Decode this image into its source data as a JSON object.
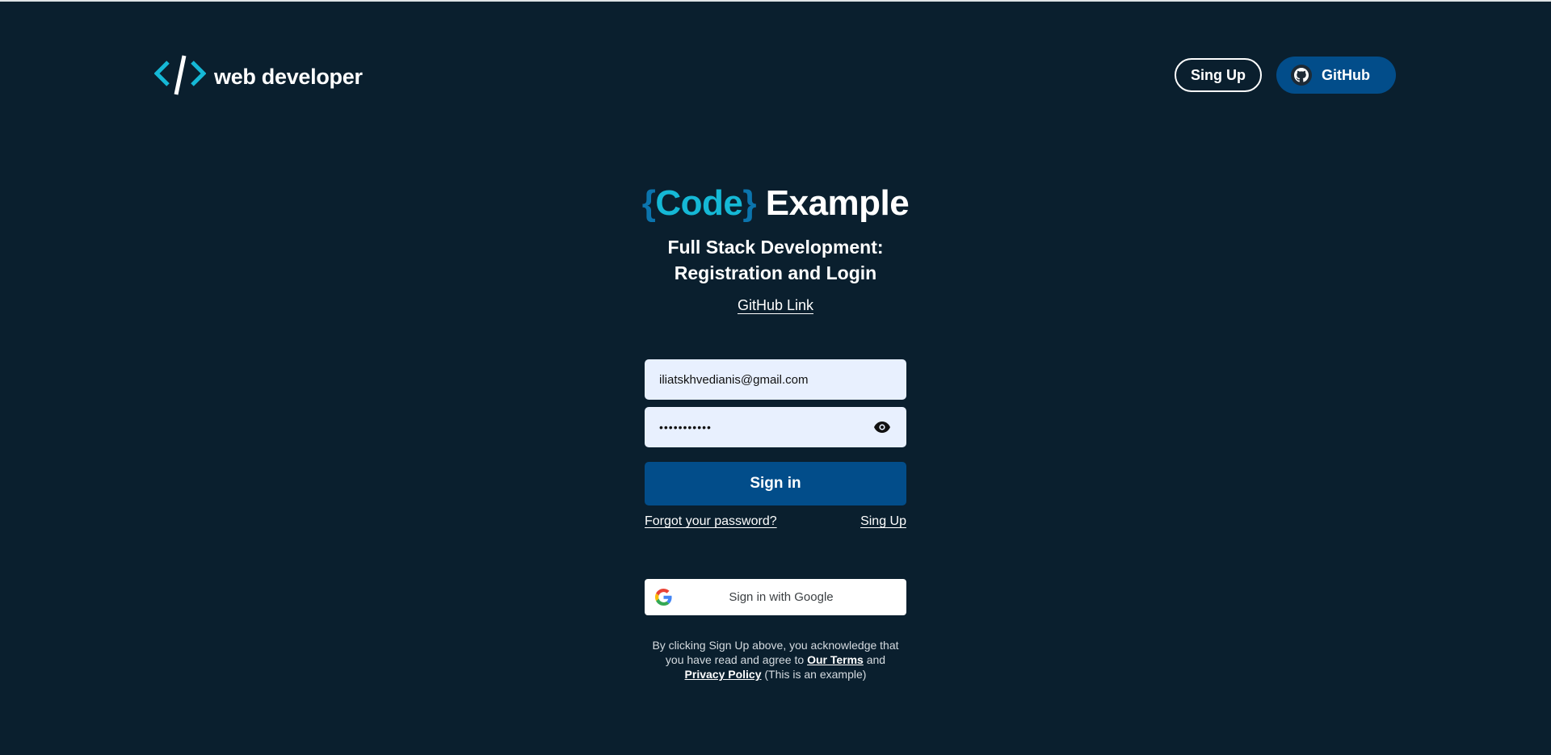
{
  "header": {
    "logo_text": "web developer",
    "signup_label": "Sing Up",
    "github_label": "GitHub"
  },
  "hero": {
    "open_brace": "{",
    "code_word": "Code",
    "close_brace": "}",
    "title_rest": "Example",
    "subtitle_line1": "Full Stack Development:",
    "subtitle_line2": "Registration and Login",
    "link_label": "GitHub Link"
  },
  "form": {
    "email_value": "iliatskhvedianis@gmail.com",
    "password_masked": "•••••••••••",
    "signin_label": "Sign in",
    "forgot_label": "Forgot your password?",
    "signup_link_label": "Sing Up",
    "google_label": "Sign in with Google"
  },
  "legal": {
    "part1": "By clicking Sign Up above, you acknowledge that you have read and agree to ",
    "terms": "Our Terms",
    "part2": " and ",
    "privacy": "Privacy Policy",
    "part3": " (This is an example)"
  },
  "icons": {
    "logo": "code-brackets-icon",
    "github": "github-icon",
    "eye": "eye-icon",
    "google": "google-icon"
  },
  "colors": {
    "background": "#0a1f2e",
    "primary_button": "#024d8a",
    "code_accent": "#15b8d6",
    "brace_accent": "#0b74ad",
    "input_bg": "#e8f0fe"
  }
}
